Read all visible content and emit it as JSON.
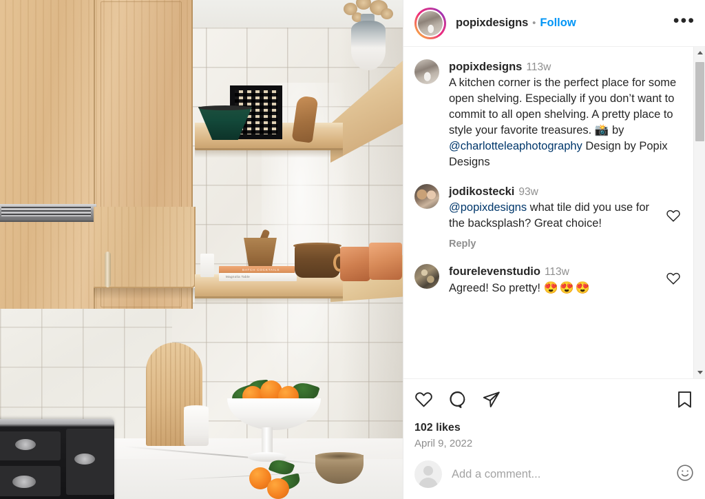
{
  "header": {
    "username": "popixdesigns",
    "separator": "•",
    "follow_label": "Follow",
    "more_options": "•••",
    "avatar_icon": "profile-avatar",
    "follow_color": "#0095F6"
  },
  "post": {
    "caption": {
      "username": "popixdesigns",
      "time_ago": "113w",
      "text_before": "A kitchen corner is the perfect place for some open shelving. Especially if you don’t want to commit to all open shelving. A pretty place to style your favorite treasures. ",
      "camera_emoji": "📸",
      "text_mid": " by ",
      "mention": "@charlotteleaphotography",
      "text_after": " Design by Popix Designs"
    },
    "comments": [
      {
        "username": "jodikostecki",
        "time_ago": "93w",
        "mention": "@popixdesigns",
        "text": " what tile did you use for the backsplash? Great choice!",
        "reply_label": "Reply",
        "like_icon": "heart-icon"
      },
      {
        "username": "fourelevenstudio",
        "time_ago": "113w",
        "mention": "",
        "text": "Agreed! So pretty! ",
        "emojis": "😍😍😍",
        "reply_label": "",
        "like_icon": "heart-icon"
      }
    ],
    "actions": {
      "like_icon": "heart-icon",
      "comment_icon": "speech-bubble-icon",
      "share_icon": "paper-plane-icon",
      "save_icon": "bookmark-icon"
    },
    "likes": "102 likes",
    "date": "April 9, 2022"
  },
  "add_comment": {
    "placeholder": "Add a comment...",
    "value": "",
    "avatar_icon": "default-user-avatar",
    "emoji_icon": "smiley-face-icon"
  },
  "scrollbar": {
    "up_arrow": "scroll-up-arrow",
    "down_arrow": "scroll-down-arrow",
    "thumb": "scroll-thumb"
  },
  "photo": {
    "alt": "Kitchen corner with light oak cabinets, white zellige tile backsplash, two floating oak shelves, marble countertop, gas cooktop, arched wood cutting board, white pedestal bowl of clementines and a woven bowl",
    "books": {
      "orange_title": "BATCH COCKTAILS",
      "white_title": "Magnolia Table"
    }
  }
}
